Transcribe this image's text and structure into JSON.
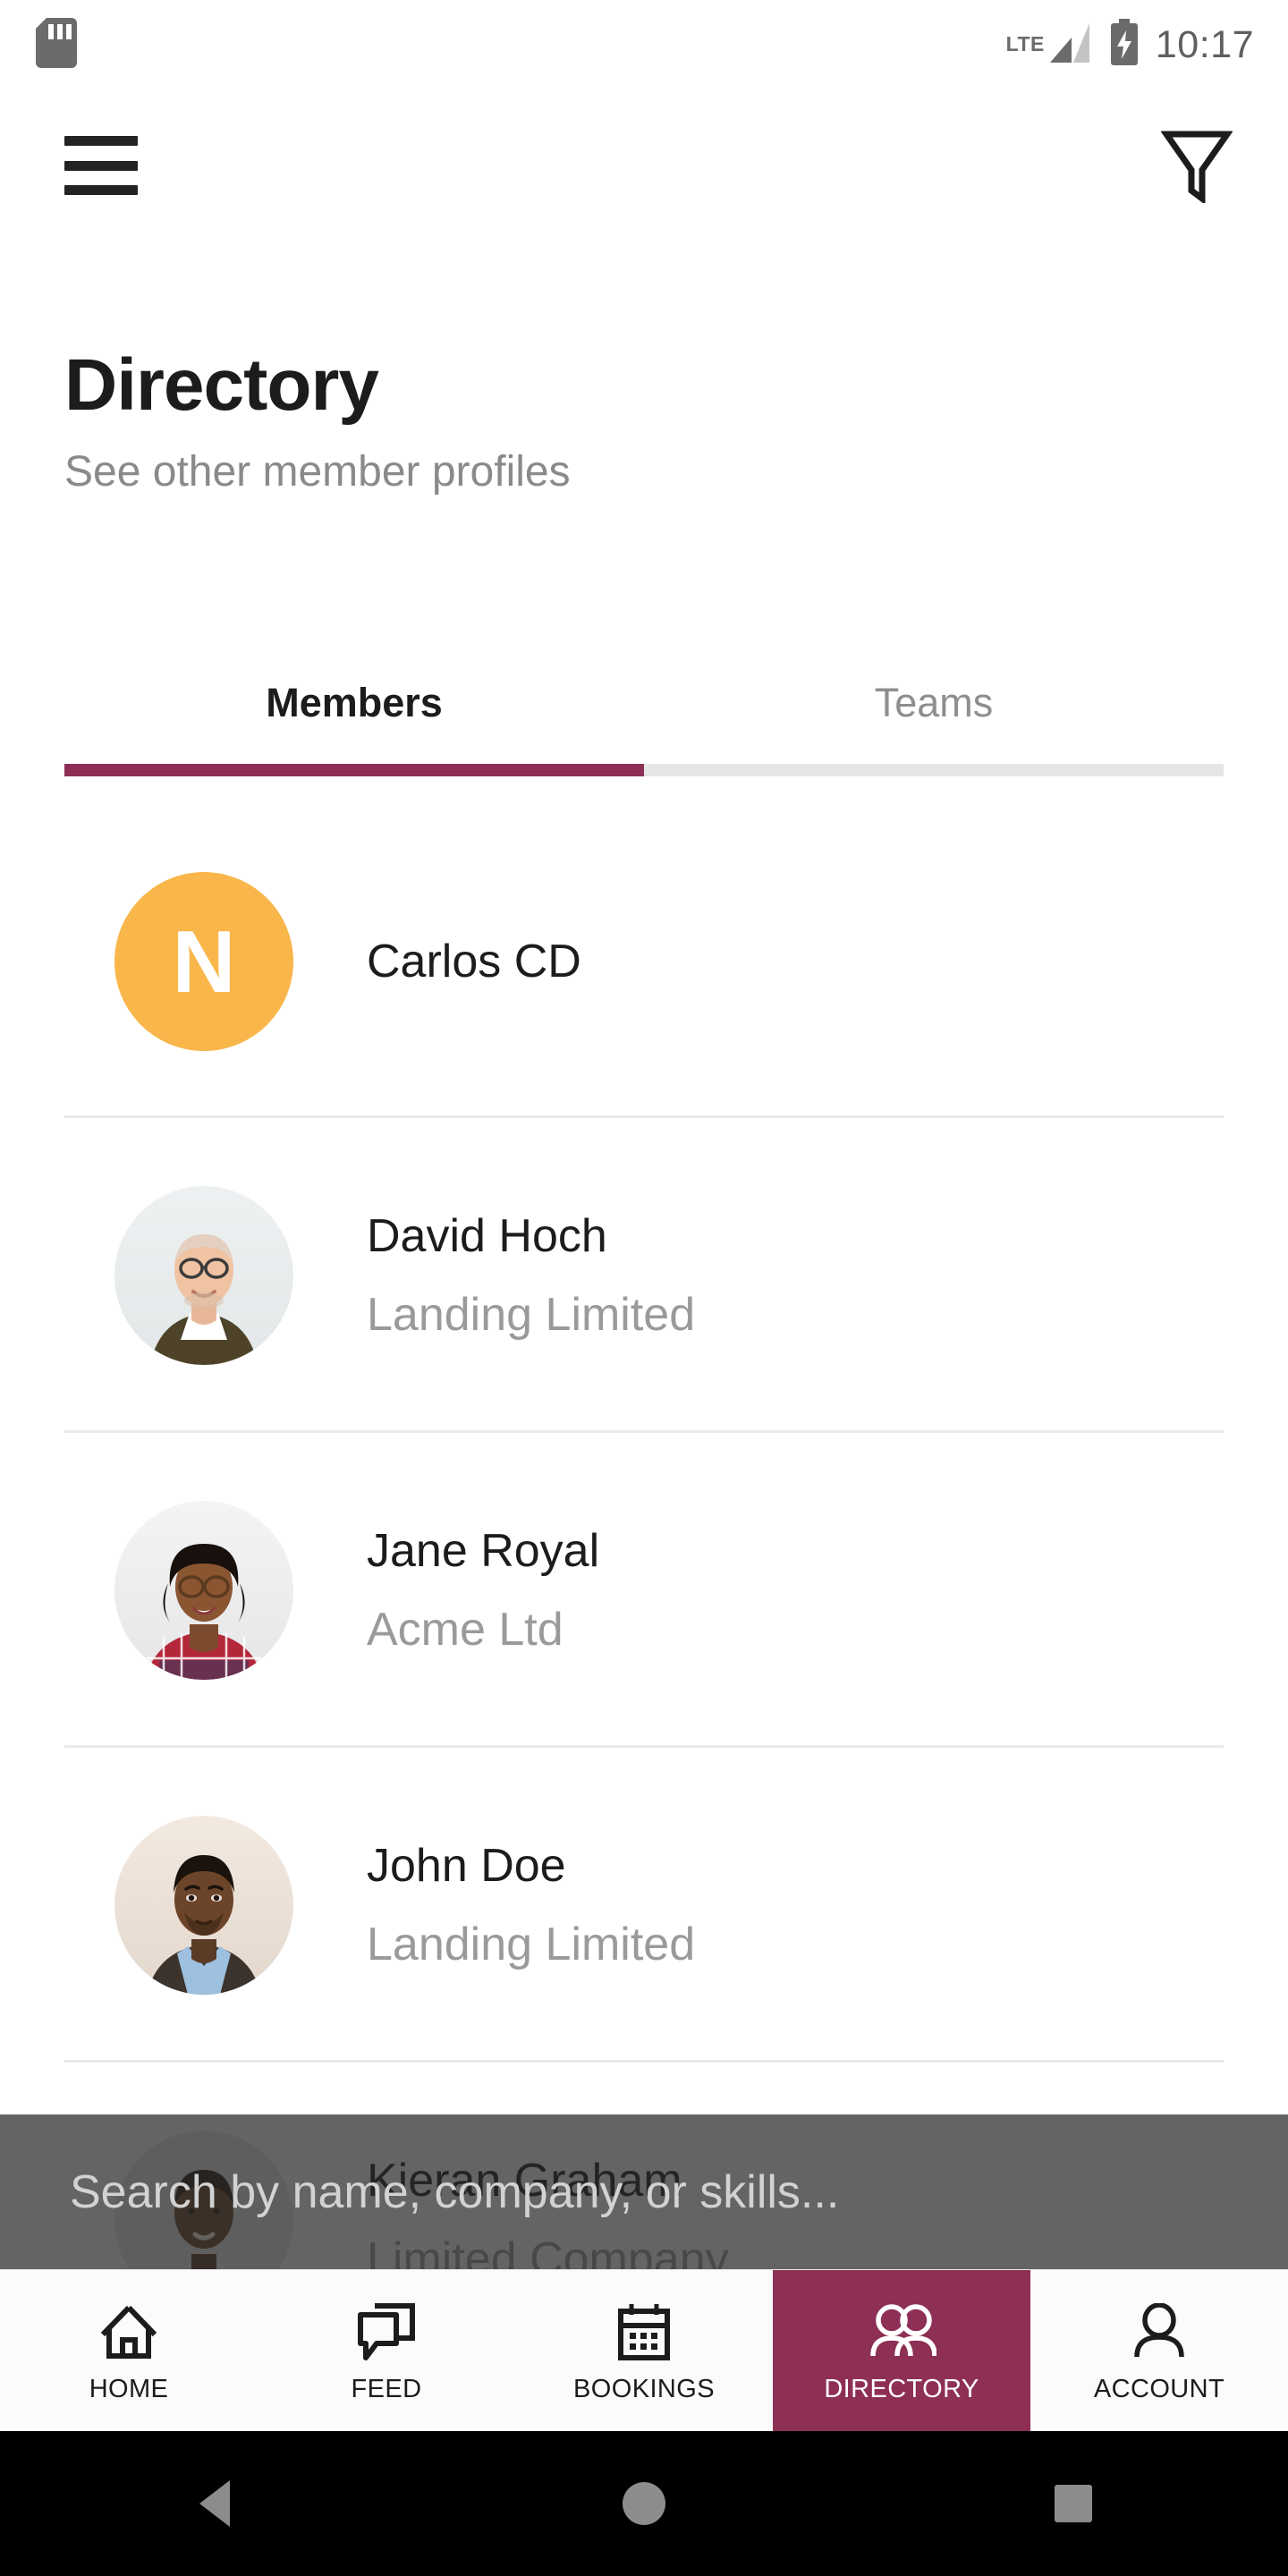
{
  "statusbar": {
    "sd_icon": "sd-card-icon",
    "network": "LTE",
    "signal_icon": "signal-bars-icon",
    "battery_icon": "battery-charging-icon",
    "time": "10:17"
  },
  "appbar": {
    "menu_icon": "hamburger-menu-icon",
    "filter_icon": "filter-funnel-icon"
  },
  "header": {
    "title": "Directory",
    "subtitle": "See other member profiles"
  },
  "tabs": {
    "items": [
      {
        "label": "Members",
        "active": true
      },
      {
        "label": "Teams",
        "active": false
      }
    ],
    "active_index": 0,
    "indicator_color": "#8e3055",
    "track_color": "#e6e6e6"
  },
  "members": [
    {
      "name": "Carlos CD",
      "company": "",
      "avatar_type": "initial",
      "initial": "N",
      "avatar_color": "#f9b64b"
    },
    {
      "name": "David Hoch",
      "company": "Landing Limited",
      "avatar_type": "photo",
      "initial": "",
      "avatar_color": "#eceff0"
    },
    {
      "name": "Jane Royal",
      "company": "Acme Ltd",
      "avatar_type": "photo",
      "initial": "",
      "avatar_color": "#f1f1f2"
    },
    {
      "name": "John Doe",
      "company": "Landing Limited",
      "avatar_type": "photo",
      "initial": "",
      "avatar_color": "#efe7e0"
    },
    {
      "name": "Kieran Graham",
      "company": "Limited Company",
      "avatar_type": "photo",
      "initial": "",
      "avatar_color": "#e8e8e8"
    }
  ],
  "search": {
    "placeholder": "Search by name, company, or skills...",
    "value": "",
    "overlay_color": "#5a5a5a"
  },
  "bottomnav": {
    "items": [
      {
        "label": "HOME",
        "icon": "home-icon",
        "active": false
      },
      {
        "label": "FEED",
        "icon": "chat-bubbles-icon",
        "active": false
      },
      {
        "label": "BOOKINGS",
        "icon": "calendar-icon",
        "active": false
      },
      {
        "label": "DIRECTORY",
        "icon": "people-icon",
        "active": true
      },
      {
        "label": "ACCOUNT",
        "icon": "person-icon",
        "active": false
      }
    ],
    "active_color": "#8e3055"
  },
  "androidnav": {
    "back_icon": "back-triangle-icon",
    "home_icon": "home-circle-icon",
    "recent_icon": "recent-square-icon"
  }
}
